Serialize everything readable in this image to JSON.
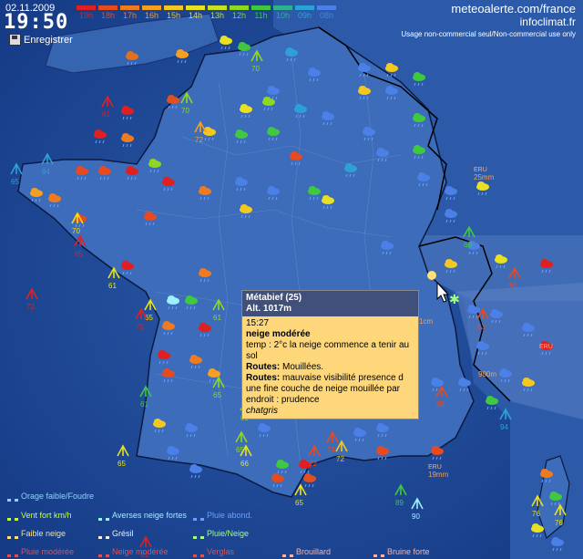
{
  "header": {
    "date": "02.11.2009",
    "time": "19:50",
    "save_label": "Enregistrer",
    "site": "meteoalerte.com/france",
    "site2": "infoclimat.fr",
    "usage_note": "Usage non-commercial seul/Non-commercial use only"
  },
  "hours": [
    {
      "label": "19h",
      "color": "#e02020"
    },
    {
      "label": "18h",
      "color": "#e84a20"
    },
    {
      "label": "17h",
      "color": "#f07a20"
    },
    {
      "label": "16h",
      "color": "#f5a020"
    },
    {
      "label": "15h",
      "color": "#f5c820"
    },
    {
      "label": "14h",
      "color": "#e8e020"
    },
    {
      "label": "13h",
      "color": "#c8e020"
    },
    {
      "label": "12h",
      "color": "#8ed820"
    },
    {
      "label": "11h",
      "color": "#40c840"
    },
    {
      "label": "10h",
      "color": "#30b090"
    },
    {
      "label": "09h",
      "color": "#2ea0d8"
    },
    {
      "label": "08h",
      "color": "#4a80e8"
    }
  ],
  "tooltip": {
    "station": "Métabief (25)",
    "altitude": "Alt. 1017m",
    "obs_time": "15:27",
    "weather": "neige modérée",
    "temp_label": "temp :",
    "temp_text": "2°c la neige commence a tenir au sol",
    "routes_label": "Routes:",
    "routes_text": "Mouillées.",
    "routes2_label": "Routes:",
    "routes2_text": "mauvaise visibilité presence d une fine couche de neige mouillée par endroit : prudence",
    "author": "chatgris"
  },
  "wind_labels": [
    "61",
    "70",
    "70",
    "72",
    "94",
    "65",
    "70",
    "65",
    "72",
    "61",
    "65",
    "70",
    "61",
    "61",
    "65",
    "65",
    "66",
    "65",
    "65",
    "72",
    "72",
    "89",
    "90",
    "76",
    "76",
    "61",
    "65",
    "69",
    "81",
    "63",
    "94",
    "65",
    "74"
  ],
  "snow_labels": [
    "25mm",
    "1cm",
    "900m",
    "19mm"
  ],
  "cam_labels": [
    "ERU",
    "ERU",
    "ERU"
  ],
  "legend": [
    {
      "label": "Orage faible/Foudre",
      "color": "#8fd0ff"
    },
    {
      "label": "Averses neige fortes",
      "color": "#9ef0ff"
    },
    {
      "label": "Pluie abond.",
      "color": "#6aa0ff"
    },
    {
      "label": "Vent fort km/h",
      "color": "#c8ff40"
    },
    {
      "label": "Grésil",
      "color": "#f0f0f0"
    },
    {
      "label": "Faible neige",
      "color": "#ffe070"
    },
    {
      "label": "Pluie/Neige",
      "color": "#a0ff80"
    },
    {
      "label": "Pluie modérée",
      "color": "#e05050"
    },
    {
      "label": "Neige modérée",
      "color": "#e05050"
    },
    {
      "label": "Verglas",
      "color": "#e05050"
    },
    {
      "label": "Brouillard",
      "color": "#ffb0a0"
    },
    {
      "label": "Bruine forte",
      "color": "#ffb0a0"
    }
  ]
}
